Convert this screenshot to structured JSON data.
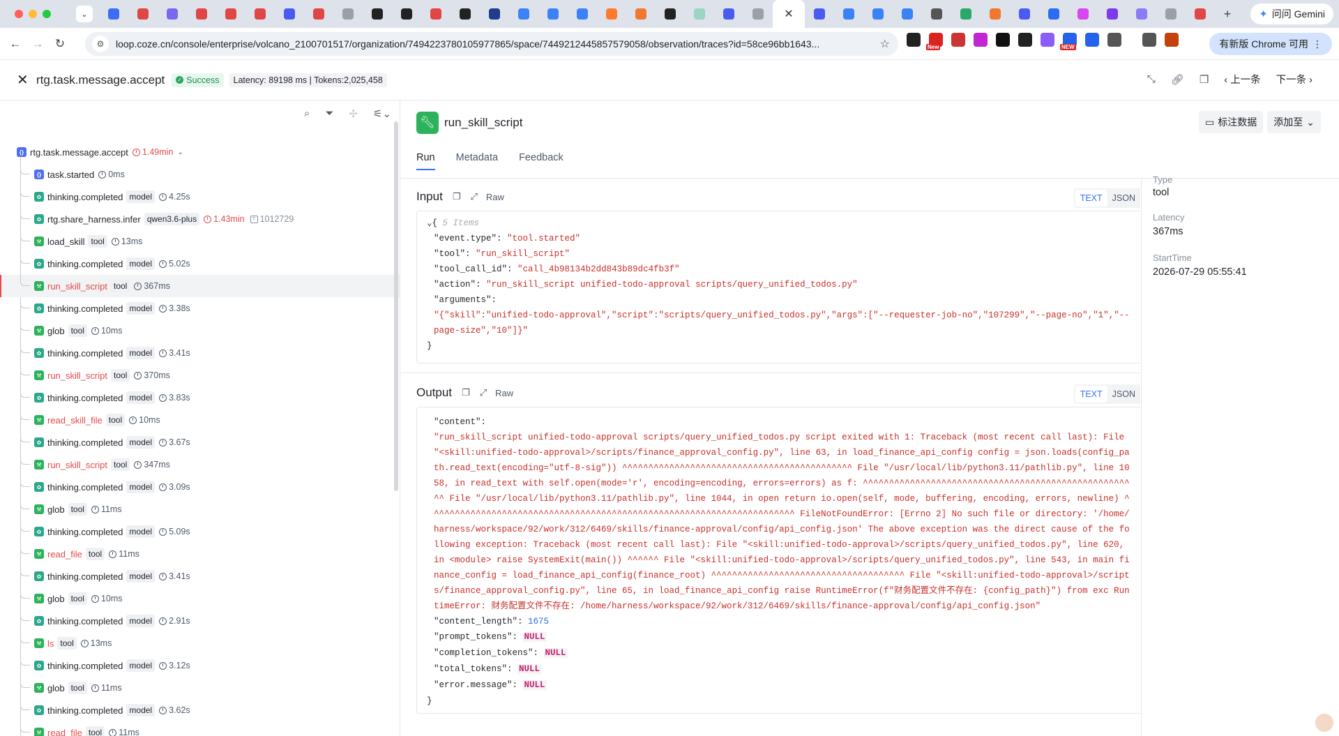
{
  "browser": {
    "gemini_label": "问问 Gemini",
    "url": "loop.coze.cn/console/enterprise/volcano_2100701517/organization/7494223780105977865/space/7449212445857579058/observation/traces?id=58ce96bb1643...",
    "update_label": "有新版 Chrome 可用"
  },
  "header": {
    "title": "rtg.task.message.accept",
    "status": "Success",
    "latency_tokens": "Latency: 89198 ms | Tokens:2,025,458",
    "prev_label": "上一条",
    "next_label": "下一条"
  },
  "tree": {
    "root": {
      "name": "rtg.task.message.accept",
      "time": "1.49min"
    },
    "nodes": [
      {
        "name": "task.started",
        "tag": "",
        "time": "0ms",
        "kind": "root",
        "err": false
      },
      {
        "name": "thinking.completed",
        "tag": "model",
        "time": "4.25s",
        "kind": "model",
        "err": false
      },
      {
        "name": "rtg.share_harness.infer",
        "tag": "qwen3.6-plus",
        "time": "1.43min",
        "kind": "model",
        "err": false,
        "time_err": true,
        "tokens": "1012729"
      },
      {
        "name": "load_skill",
        "tag": "tool",
        "time": "13ms",
        "kind": "tool",
        "err": false
      },
      {
        "name": "thinking.completed",
        "tag": "model",
        "time": "5.02s",
        "kind": "model",
        "err": false
      },
      {
        "name": "run_skill_script",
        "tag": "tool",
        "time": "367ms",
        "kind": "tool",
        "err": true,
        "selected": true
      },
      {
        "name": "thinking.completed",
        "tag": "model",
        "time": "3.38s",
        "kind": "model",
        "err": false
      },
      {
        "name": "glob",
        "tag": "tool",
        "time": "10ms",
        "kind": "tool",
        "err": false
      },
      {
        "name": "thinking.completed",
        "tag": "model",
        "time": "3.41s",
        "kind": "model",
        "err": false
      },
      {
        "name": "run_skill_script",
        "tag": "tool",
        "time": "370ms",
        "kind": "tool",
        "err": true
      },
      {
        "name": "thinking.completed",
        "tag": "model",
        "time": "3.83s",
        "kind": "model",
        "err": false
      },
      {
        "name": "read_skill_file",
        "tag": "tool",
        "time": "10ms",
        "kind": "tool",
        "err": true
      },
      {
        "name": "thinking.completed",
        "tag": "model",
        "time": "3.67s",
        "kind": "model",
        "err": false
      },
      {
        "name": "run_skill_script",
        "tag": "tool",
        "time": "347ms",
        "kind": "tool",
        "err": true
      },
      {
        "name": "thinking.completed",
        "tag": "model",
        "time": "3.09s",
        "kind": "model",
        "err": false
      },
      {
        "name": "glob",
        "tag": "tool",
        "time": "11ms",
        "kind": "tool",
        "err": false
      },
      {
        "name": "thinking.completed",
        "tag": "model",
        "time": "5.09s",
        "kind": "model",
        "err": false
      },
      {
        "name": "read_file",
        "tag": "tool",
        "time": "11ms",
        "kind": "tool",
        "err": true
      },
      {
        "name": "thinking.completed",
        "tag": "model",
        "time": "3.41s",
        "kind": "model",
        "err": false
      },
      {
        "name": "glob",
        "tag": "tool",
        "time": "10ms",
        "kind": "tool",
        "err": false
      },
      {
        "name": "thinking.completed",
        "tag": "model",
        "time": "2.91s",
        "kind": "model",
        "err": false
      },
      {
        "name": "ls",
        "tag": "tool",
        "time": "13ms",
        "kind": "tool",
        "err": true
      },
      {
        "name": "thinking.completed",
        "tag": "model",
        "time": "3.12s",
        "kind": "model",
        "err": false
      },
      {
        "name": "glob",
        "tag": "tool",
        "time": "11ms",
        "kind": "tool",
        "err": false
      },
      {
        "name": "thinking.completed",
        "tag": "model",
        "time": "3.62s",
        "kind": "model",
        "err": false
      },
      {
        "name": "read_file",
        "tag": "tool",
        "time": "11ms",
        "kind": "tool",
        "err": true
      }
    ]
  },
  "main": {
    "title": "run_skill_script",
    "annotate_label": "标注数据",
    "add_to_label": "添加至",
    "tabs": [
      "Run",
      "Metadata",
      "Feedback"
    ],
    "input_label": "Input",
    "output_label": "Output",
    "raw_label": "Raw",
    "text_label": "TEXT",
    "json_label": "JSON",
    "input": {
      "items_comment": "5 Items",
      "event_type": "\"tool.started\"",
      "tool": "\"run_skill_script\"",
      "tool_call_id": "\"call_4b98134b2dd843b89dc4fb3f\"",
      "action": "\"run_skill_script unified-todo-approval scripts/query_unified_todos.py\"",
      "arguments": "\"{\"skill\":\"unified-todo-approval\",\"script\":\"scripts/query_unified_todos.py\",\"args\":[\"--requester-job-no\",\"107299\",\"--page-no\",\"1\",\"--page-size\",\"10\"]}\""
    },
    "output": {
      "content": "\"run_skill_script unified-todo-approval scripts/query_unified_todos.py script exited with 1: Traceback (most recent call last): File \"<skill:unified-todo-approval>/scripts/finance_approval_config.py\", line 63, in load_finance_api_config config = json.loads(config_path.read_text(encoding=\"utf-8-sig\")) ^^^^^^^^^^^^^^^^^^^^^^^^^^^^^^^^^^^^^^^^^^^^ File \"/usr/local/lib/python3.11/pathlib.py\", line 1058, in read_text with self.open(mode='r', encoding=encoding, errors=errors) as f: ^^^^^^^^^^^^^^^^^^^^^^^^^^^^^^^^^^^^^^^^^^^^^^^^^^^^^ File \"/usr/local/lib/python3.11/pathlib.py\", line 1044, in open return io.open(self, mode, buffering, encoding, errors, newline) ^^^^^^^^^^^^^^^^^^^^^^^^^^^^^^^^^^^^^^^^^^^^^^^^^^^^^^^^^^^^^^^^^^^^^^ FileNotFoundError: [Errno 2] No such file or directory: '/home/harness/workspace/92/work/312/6469/skills/finance-approval/config/api_config.json' The above exception was the direct cause of the following exception: Traceback (most recent call last): File \"<skill:unified-todo-approval>/scripts/query_unified_todos.py\", line 620, in <module> raise SystemExit(main()) ^^^^^^ File \"<skill:unified-todo-approval>/scripts/query_unified_todos.py\", line 543, in main finance_config = load_finance_api_config(finance_root) ^^^^^^^^^^^^^^^^^^^^^^^^^^^^^^^^^^^^^ File \"<skill:unified-todo-approval>/scripts/finance_approval_config.py\", line 65, in load_finance_api_config raise RuntimeError(f\"财务配置文件不存在: {config_path}\") from exc RuntimeError: 财务配置文件不存在: /home/harness/workspace/92/work/312/6469/skills/finance-approval/config/api_config.json\"",
      "content_length": "1675",
      "null_value": "NULL"
    }
  },
  "meta": {
    "type_label": "Type",
    "type_value": "tool",
    "latency_label": "Latency",
    "latency_value": "367ms",
    "start_label": "StartTime",
    "start_value": "2026-07-29 05:55:41"
  },
  "colors": {
    "error": "#e34b4b",
    "success": "#2ea55d",
    "accent": "#3370ff"
  }
}
